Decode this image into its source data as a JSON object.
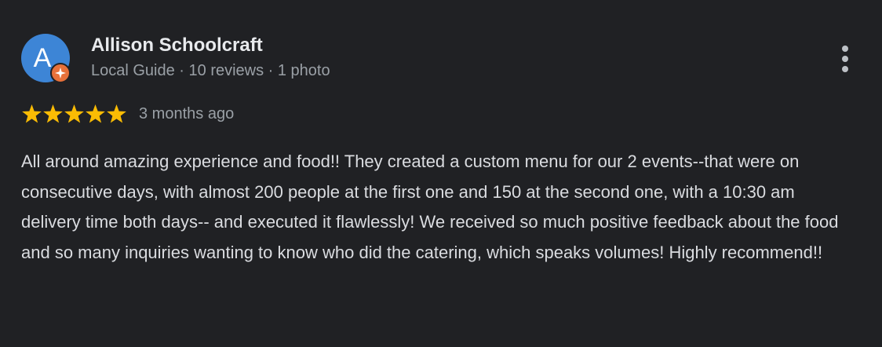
{
  "review": {
    "author": {
      "name": "Allison Schoolcraft",
      "avatar_letter": "A",
      "avatar_color": "#3d85d6",
      "badge_icon": "local-guide-star-icon",
      "badge_color": "#e8713a",
      "meta": "Local Guide · 10 reviews · 1 photo"
    },
    "more_icon": "more-vertical-icon",
    "rating": {
      "stars": 5,
      "max": 5,
      "star_color": "#fbbc04",
      "star_icon": "star-icon"
    },
    "time_ago": "3 months ago",
    "text": "All around amazing experience and food!! They created a custom menu for our 2 events--that were on consecutive days, with almost 200 people at the first one and 150 at the second one, with a 10:30 am delivery time both days-- and executed it flawlessly! We received so much positive feedback about the food and so many inquiries wanting to know who did the catering, which speaks volumes! Highly recommend!!"
  }
}
